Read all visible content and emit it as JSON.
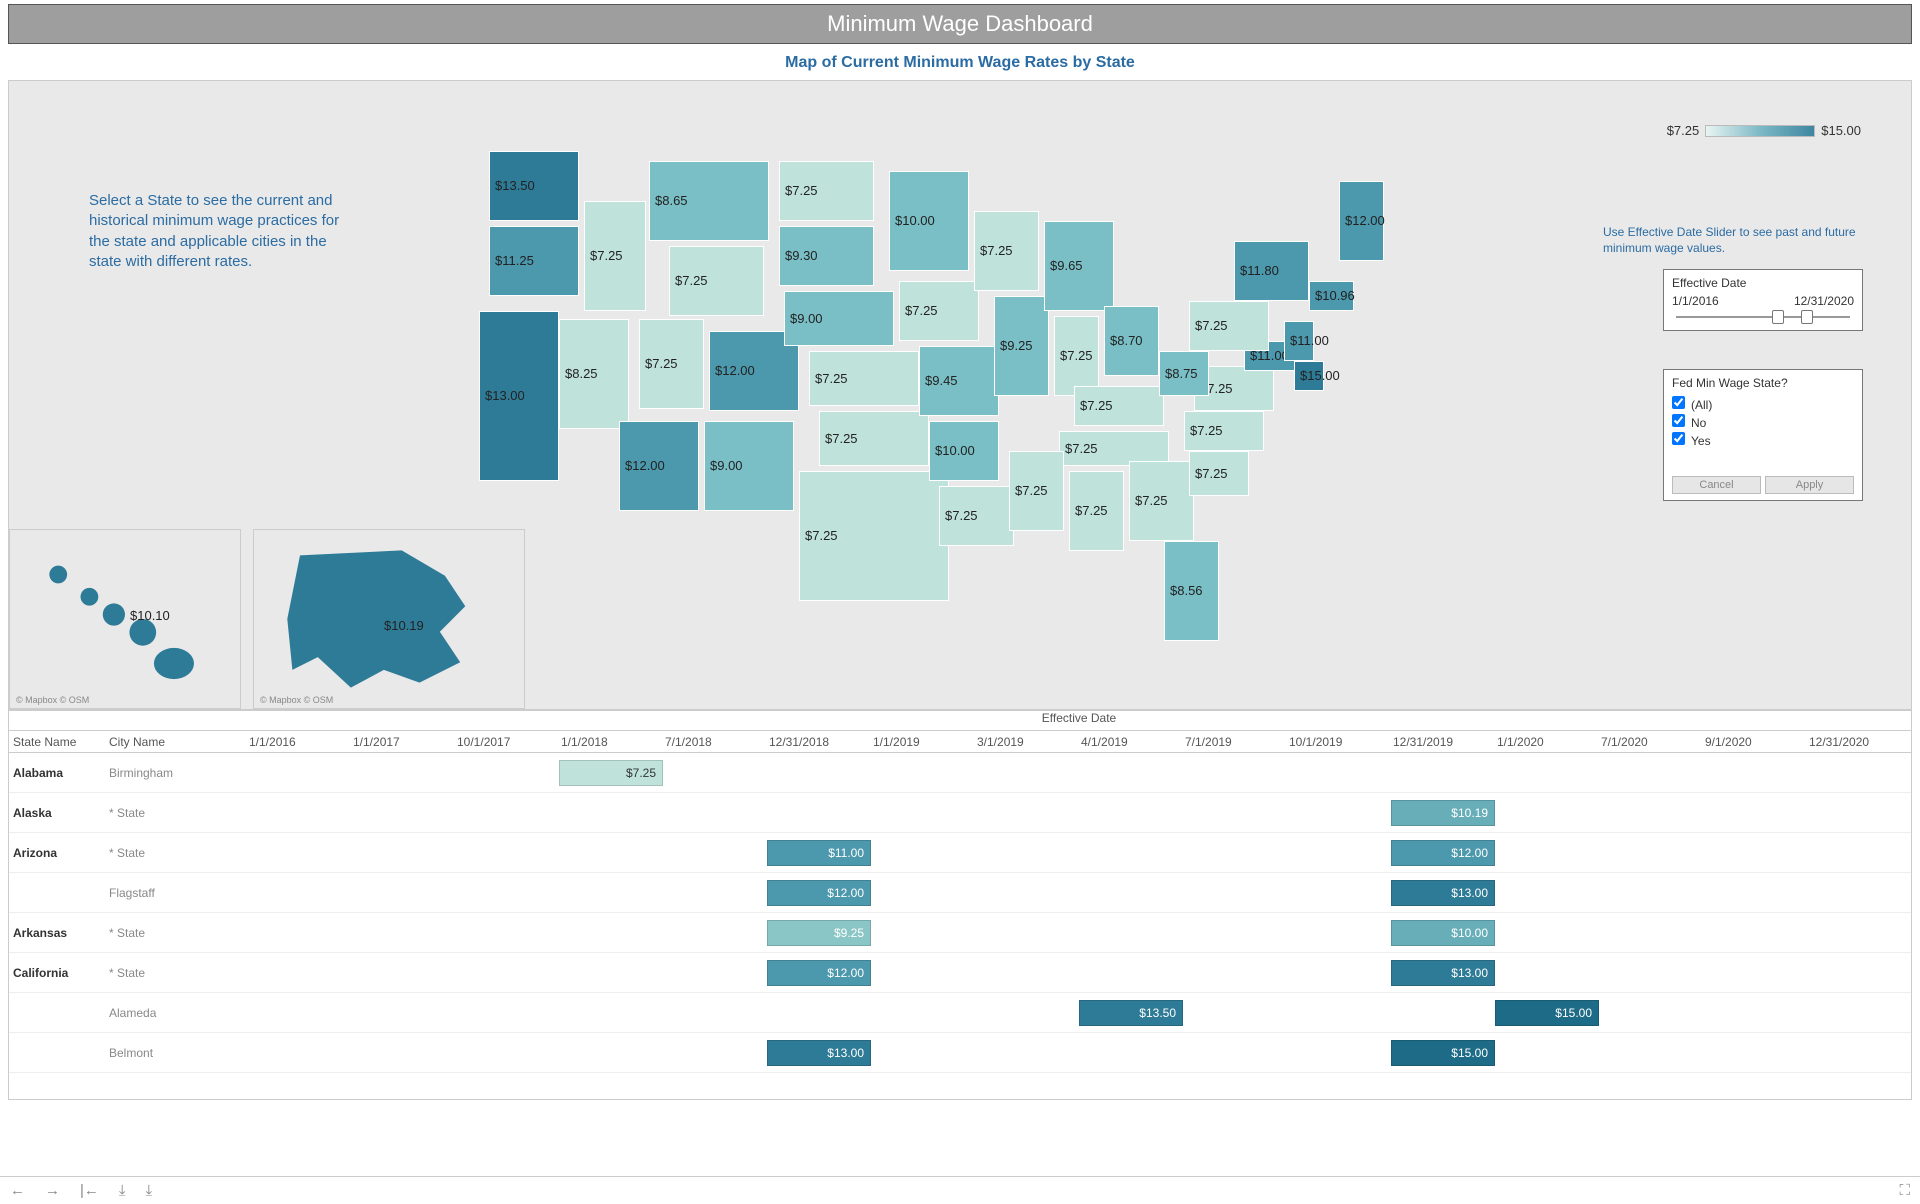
{
  "title": "Minimum Wage Dashboard",
  "subtitle": "Map of Current Minimum Wage Rates by State",
  "instruction": "Select a State to see the current and historical minimum wage practices for the state and applicable cities in the state with different rates.",
  "legend": {
    "min": "$7.25",
    "max": "$15.00"
  },
  "right_hint": "Use Effective Date Slider to see past and future minimum wage values.",
  "slider": {
    "title": "Effective Date",
    "start": "1/1/2016",
    "end": "12/31/2020"
  },
  "filter": {
    "title": "Fed Min Wage State?",
    "all": "(All)",
    "no": "No",
    "yes": "Yes",
    "cancel": "Cancel",
    "apply": "Apply"
  },
  "inset": {
    "hawaii_val": "$10.10",
    "alaska_val": "$10.19",
    "credit": "© Mapbox  © OSM"
  },
  "grid": {
    "eff_label": "Effective Date",
    "col_state": "State Name",
    "col_city": "City Name",
    "dates": [
      "1/1/2016",
      "1/1/2017",
      "10/1/2017",
      "1/1/2018",
      "7/1/2018",
      "12/31/2018",
      "1/1/2019",
      "3/1/2019",
      "4/1/2019",
      "7/1/2019",
      "10/1/2019",
      "12/31/2019",
      "1/1/2020",
      "7/1/2020",
      "9/1/2020",
      "12/31/2020"
    ]
  },
  "footer_icons": [
    "←",
    "→",
    "|←",
    "⧉",
    "⧉"
  ],
  "chart_data": {
    "map": {
      "type": "choropleth-map",
      "title": "Map of Current Minimum Wage Rates by State",
      "colorbar": {
        "min": 7.25,
        "max": 15.0
      },
      "values": [
        {
          "state": "Washington",
          "value": 13.5
        },
        {
          "state": "Oregon",
          "value": 11.25
        },
        {
          "state": "California",
          "value": 13.0
        },
        {
          "state": "Idaho",
          "value": 7.25
        },
        {
          "state": "Nevada",
          "value": 8.25
        },
        {
          "state": "Utah",
          "value": 7.25
        },
        {
          "state": "Arizona",
          "value": 12.0
        },
        {
          "state": "Montana",
          "value": 8.65
        },
        {
          "state": "Wyoming",
          "value": 7.25
        },
        {
          "state": "Colorado",
          "value": 12.0
        },
        {
          "state": "New Mexico",
          "value": 9.0
        },
        {
          "state": "North Dakota",
          "value": 7.25
        },
        {
          "state": "South Dakota",
          "value": 9.3
        },
        {
          "state": "Nebraska",
          "value": 9.0
        },
        {
          "state": "Kansas",
          "value": 7.25
        },
        {
          "state": "Oklahoma",
          "value": 7.25
        },
        {
          "state": "Texas",
          "value": 7.25
        },
        {
          "state": "Minnesota",
          "value": 10.0
        },
        {
          "state": "Iowa",
          "value": 7.25
        },
        {
          "state": "Missouri",
          "value": 9.45
        },
        {
          "state": "Arkansas",
          "value": 10.0
        },
        {
          "state": "Louisiana",
          "value": 7.25
        },
        {
          "state": "Wisconsin",
          "value": 7.25
        },
        {
          "state": "Illinois",
          "value": 9.25
        },
        {
          "state": "Michigan",
          "value": 9.65
        },
        {
          "state": "Indiana",
          "value": 7.25
        },
        {
          "state": "Ohio",
          "value": 8.7
        },
        {
          "state": "Kentucky",
          "value": 7.25
        },
        {
          "state": "Tennessee",
          "value": 7.25
        },
        {
          "state": "Mississippi",
          "value": 7.25
        },
        {
          "state": "Alabama",
          "value": 7.25
        },
        {
          "state": "Georgia",
          "value": 7.25
        },
        {
          "state": "Florida",
          "value": 8.56
        },
        {
          "state": "South Carolina",
          "value": 7.25
        },
        {
          "state": "North Carolina",
          "value": 7.25
        },
        {
          "state": "Virginia",
          "value": 7.25
        },
        {
          "state": "West Virginia",
          "value": 8.75
        },
        {
          "state": "Maryland",
          "value": 11.0
        },
        {
          "state": "Delaware",
          "value": 15.0
        },
        {
          "state": "Pennsylvania",
          "value": 7.25
        },
        {
          "state": "New Jersey",
          "value": 11.0
        },
        {
          "state": "New York",
          "value": 11.8
        },
        {
          "state": "Connecticut",
          "value": 10.96
        },
        {
          "state": "Maine",
          "value": 12.0
        },
        {
          "state": "Alaska",
          "value": 10.19
        },
        {
          "state": "Hawaii",
          "value": 10.1
        }
      ]
    },
    "timeline": {
      "type": "gantt",
      "x_dates": [
        "1/1/2016",
        "1/1/2017",
        "10/1/2017",
        "1/1/2018",
        "7/1/2018",
        "12/31/2018",
        "1/1/2019",
        "3/1/2019",
        "4/1/2019",
        "7/1/2019",
        "10/1/2019",
        "12/31/2019",
        "1/1/2020",
        "7/1/2020",
        "9/1/2020",
        "12/31/2020"
      ],
      "rows": [
        {
          "state": "Alabama",
          "city": "Birmingham",
          "bars": [
            {
              "at": "7/1/2018",
              "value": 7.25
            }
          ]
        },
        {
          "state": "Alaska",
          "city": "* State",
          "bars": [
            {
              "at": "1/1/2020",
              "value": 10.19
            }
          ]
        },
        {
          "state": "Arizona",
          "city": "* State",
          "bars": [
            {
              "at": "1/1/2019",
              "value": 11.0
            },
            {
              "at": "1/1/2020",
              "value": 12.0
            }
          ]
        },
        {
          "state": "Arizona",
          "city": "Flagstaff",
          "bars": [
            {
              "at": "1/1/2019",
              "value": 12.0
            },
            {
              "at": "1/1/2020",
              "value": 13.0
            }
          ]
        },
        {
          "state": "Arkansas",
          "city": "* State",
          "bars": [
            {
              "at": "1/1/2019",
              "value": 9.25
            },
            {
              "at": "1/1/2020",
              "value": 10.0
            }
          ]
        },
        {
          "state": "California",
          "city": "* State",
          "bars": [
            {
              "at": "1/1/2019",
              "value": 12.0
            },
            {
              "at": "1/1/2020",
              "value": 13.0
            }
          ]
        },
        {
          "state": "California",
          "city": "Alameda",
          "bars": [
            {
              "at": "7/1/2019",
              "value": 13.5
            },
            {
              "at": "7/1/2020",
              "value": 15.0
            }
          ]
        },
        {
          "state": "California",
          "city": "Belmont",
          "bars": [
            {
              "at": "1/1/2019",
              "value": 13.0
            },
            {
              "at": "1/1/2020",
              "value": 15.0
            }
          ]
        }
      ]
    }
  }
}
